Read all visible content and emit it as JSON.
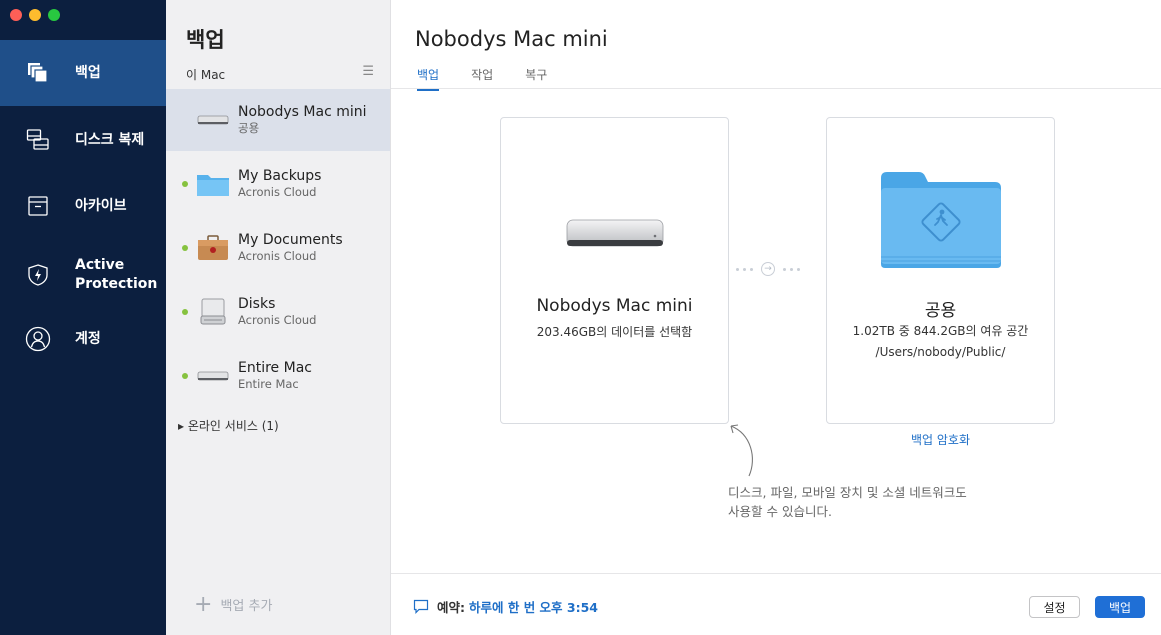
{
  "nav": {
    "items": [
      {
        "label": "백업",
        "icon": "backup-icon"
      },
      {
        "label": "디스크 복제",
        "icon": "disk-clone-icon"
      },
      {
        "label": "아카이브",
        "icon": "archive-icon"
      },
      {
        "label": "Active Protection",
        "icon": "shield-icon"
      },
      {
        "label": "계정",
        "icon": "account-icon"
      }
    ]
  },
  "list": {
    "title": "백업",
    "section": "이 Mac",
    "items": [
      {
        "name": "Nobodys Mac mini",
        "sub": "공용",
        "icon": "mac-mini-icon"
      },
      {
        "name": "My Backups",
        "sub": "Acronis Cloud",
        "icon": "folder-icon"
      },
      {
        "name": "My Documents",
        "sub": "Acronis Cloud",
        "icon": "briefcase-icon"
      },
      {
        "name": "Disks",
        "sub": "Acronis Cloud",
        "icon": "hard-drive-icon"
      },
      {
        "name": "Entire Mac",
        "sub": "Entire Mac",
        "icon": "mac-mini-icon"
      }
    ],
    "online_services": "▸ 온라인 서비스 (1)",
    "add_backup": "백업 추가"
  },
  "main": {
    "title": "Nobodys Mac mini",
    "tabs": [
      "백업",
      "작업",
      "복구"
    ],
    "source": {
      "name": "Nobodys Mac mini",
      "detail": "203.46GB의 데이터를 선택함"
    },
    "destination": {
      "name": "공용",
      "detail": "1.02TB 중 844.2GB의 여유 공간",
      "path": "/Users/nobody/Public/"
    },
    "encrypt_link": "백업 암호화",
    "hint_line1": "디스크, 파일, 모바일 장치 및 소셜 네트워크도",
    "hint_line2": "사용할 수 있습니다.",
    "schedule_label": "예약:",
    "schedule_value": "하루에 한 번 오후 3:54",
    "settings_button": "설정",
    "backup_button": "백업"
  },
  "colors": {
    "nav_bg": "#0c1f3f",
    "nav_active": "#1f4f89",
    "accent": "#1f6fd6",
    "status_green": "#86c23f"
  }
}
